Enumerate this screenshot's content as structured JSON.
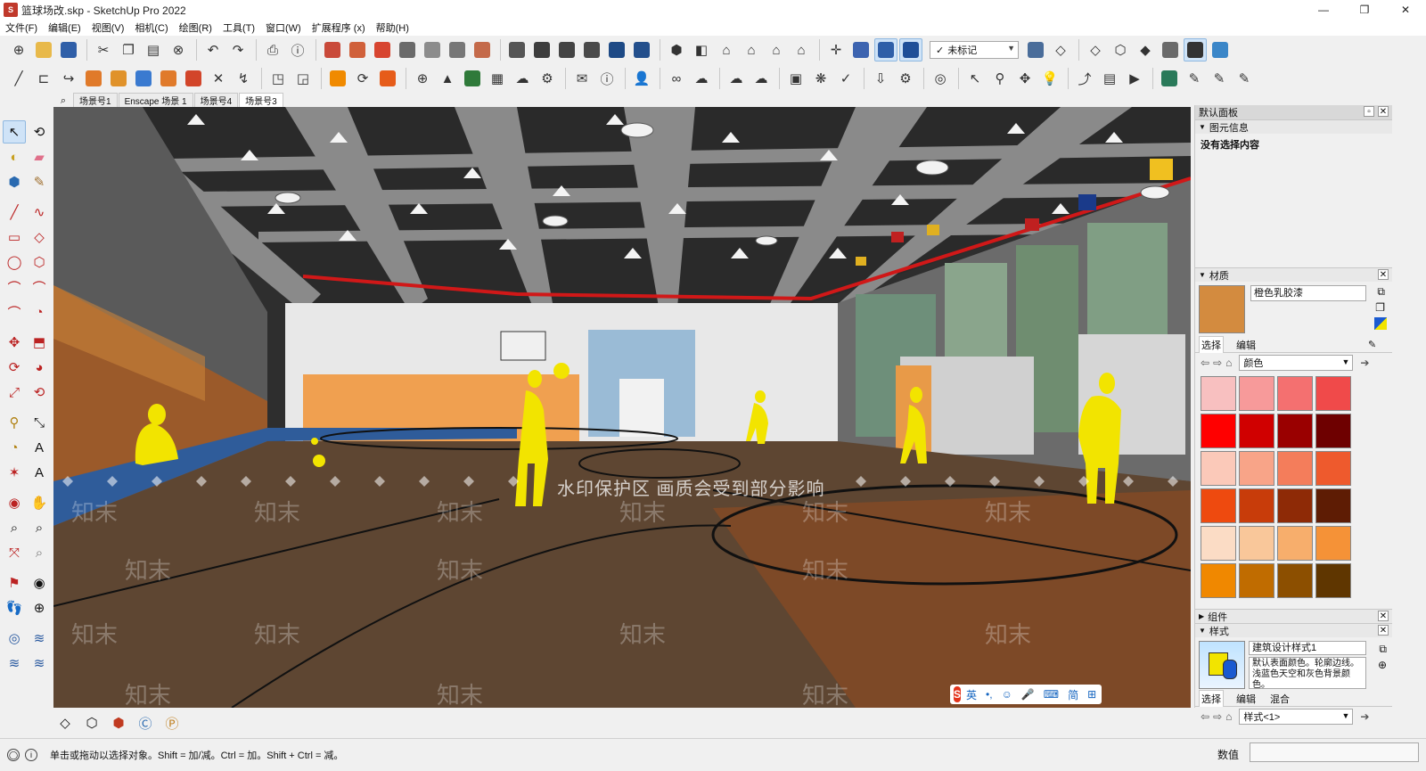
{
  "window": {
    "title": "篮球场改.skp - SketchUp Pro 2022",
    "controls": [
      "—",
      "❐",
      "✕"
    ]
  },
  "menu": [
    "文件(F)",
    "编辑(E)",
    "视图(V)",
    "相机(C)",
    "绘图(R)",
    "工具(T)",
    "窗口(W)",
    "扩展程序 (x)",
    "帮助(H)"
  ],
  "toolbar": {
    "tag_select": "未标记",
    "tag_check": "✓"
  },
  "scenes": {
    "tabs": [
      "场景号1",
      "Enscape 场景 1",
      "场景号4",
      "场景号3"
    ],
    "active_index": 3
  },
  "viewport": {
    "watermark_text": "水印保护区  画质会受到部分影响",
    "logo_text": "知末",
    "ime": {
      "logo": "S",
      "lang": "英",
      "items": [
        "•,",
        "☺",
        "🎤",
        "⌨",
        "简",
        "⊞"
      ]
    }
  },
  "panel": {
    "title": "默认面板",
    "entity_info": {
      "title": "图元信息",
      "status": "没有选择内容"
    },
    "materials": {
      "title": "材质",
      "current_name": "橙色乳胶漆",
      "current_color": "#d38b3f",
      "tabs": [
        "选择",
        "编辑"
      ],
      "library": "颜色",
      "swatches": [
        "#f8c0c0",
        "#f79a9a",
        "#f47070",
        "#f04a4a",
        "#ff0000",
        "#d00000",
        "#9a0000",
        "#6e0000",
        "#fbc9b9",
        "#f8a488",
        "#f47d5b",
        "#ee5a2d",
        "#ee4a0f",
        "#c83c0a",
        "#8e2a06",
        "#5e1c04",
        "#fbdcc5",
        "#f9c79a",
        "#f7ae6c",
        "#f59237",
        "#f08800",
        "#c06c00",
        "#8c4f00",
        "#5f3600"
      ]
    },
    "components": {
      "title": "组件"
    },
    "styles": {
      "title": "样式",
      "name": "建筑设计样式1",
      "description": "默认表面颜色。轮廓边线。浅蓝色天空和灰色背景颜色。",
      "tabs": [
        "选择",
        "编辑",
        "混合"
      ],
      "library": "样式<1>"
    }
  },
  "status": {
    "hint": "单击或拖动以选择对象。Shift = 加/减。Ctrl = 加。Shift + Ctrl = 减。",
    "measure_label": "数值"
  }
}
